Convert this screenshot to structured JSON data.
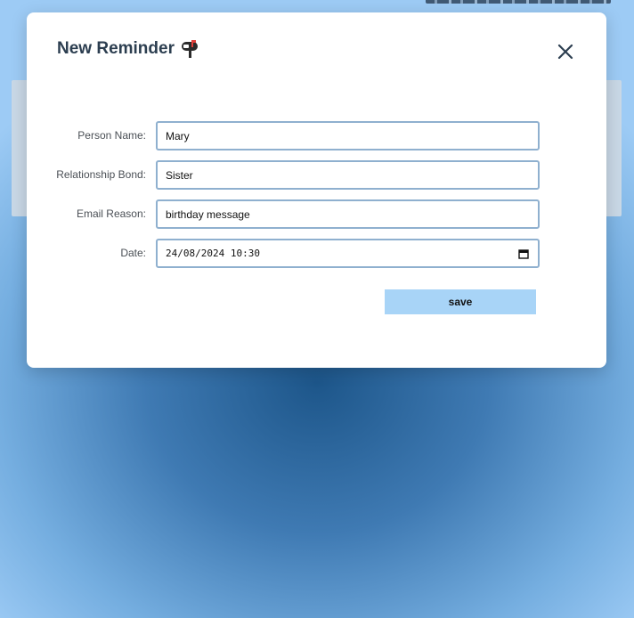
{
  "modal": {
    "title": "New Reminder",
    "title_icon": "mailbox-icon",
    "close_icon": "close-icon"
  },
  "form": {
    "person_name": {
      "label": "Person Name:",
      "value": "Mary"
    },
    "relationship_bond": {
      "label": "Relationship Bond:",
      "value": "Sister"
    },
    "email_reason": {
      "label": "Email Reason:",
      "value": "birthday message"
    },
    "date": {
      "label": "Date:",
      "value": "24/08/2024 10:30",
      "icon": "calendar-icon"
    },
    "save_label": "save"
  },
  "colors": {
    "title": "#2c3e50",
    "input_border": "#8fb0cf",
    "save_button": "#a8d4f7",
    "background_center": "#1d568a",
    "background_edge": "#9dcbf5"
  }
}
